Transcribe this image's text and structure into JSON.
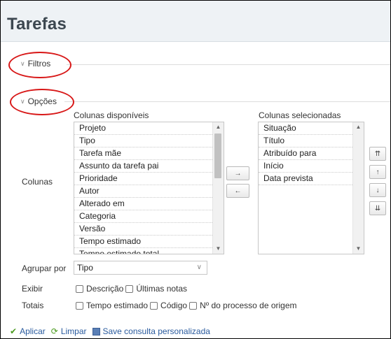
{
  "page": {
    "title": "Tarefas"
  },
  "filters": {
    "legend": "Filtros"
  },
  "options": {
    "legend": "Opções",
    "columns_label": "Colunas",
    "available": {
      "label": "Colunas disponíveis",
      "items": [
        "Projeto",
        "Tipo",
        "Tarefa mãe",
        "Assunto da tarefa pai",
        "Prioridade",
        "Autor",
        "Alterado em",
        "Categoria",
        "Versão",
        "Tempo estimado",
        "Tempo estimado total"
      ]
    },
    "selected": {
      "label": "Colunas selecionadas",
      "items": [
        "Situação",
        "Título",
        "Atribuído para",
        "Início",
        "Data prevista"
      ]
    },
    "transfer": {
      "add": "→",
      "remove": "←"
    },
    "order": {
      "top": "⇈",
      "up": "↑",
      "down": "↓",
      "bottom": "⇊"
    },
    "group_by": {
      "label": "Agrupar por",
      "value": "Tipo"
    },
    "show": {
      "label": "Exibir",
      "checkboxes": [
        "Descrição",
        "Últimas notas"
      ]
    },
    "totals": {
      "label": "Totais",
      "checkboxes": [
        "Tempo estimado",
        "Código",
        "Nº do processo de origem"
      ]
    }
  },
  "actions": {
    "apply": "Aplicar",
    "clear": "Limpar",
    "save": "Save consulta personalizada"
  },
  "colors": {
    "highlight": "#d81818",
    "link": "#2a5b9e",
    "apply_icon": "#4a9a1e"
  }
}
